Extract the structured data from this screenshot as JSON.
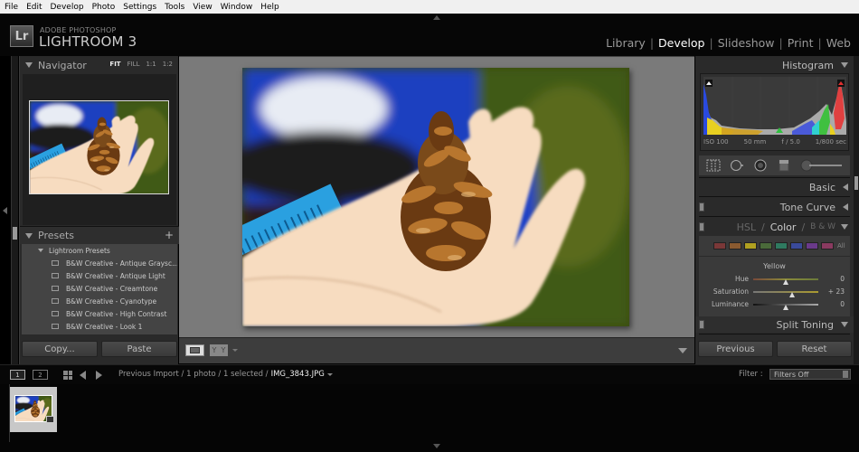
{
  "menubar": [
    "File",
    "Edit",
    "Develop",
    "Photo",
    "Settings",
    "Tools",
    "View",
    "Window",
    "Help"
  ],
  "app": {
    "logo": "Lr",
    "brand_line1": "ADOBE PHOTOSHOP",
    "brand_line2": "LIGHTROOM 3"
  },
  "modules": {
    "items": [
      "Library",
      "Develop",
      "Slideshow",
      "Print",
      "Web"
    ],
    "active": "Develop"
  },
  "navigator": {
    "title": "Navigator",
    "options": [
      "FIT",
      "FILL",
      "1:1",
      "1:2"
    ],
    "active_option": "FIT"
  },
  "presets": {
    "title": "Presets",
    "group": "Lightroom Presets",
    "items": [
      "B&W Creative - Antique Graysc...",
      "B&W Creative - Antique Light",
      "B&W Creative - Creamtone",
      "B&W Creative - Cyanotype",
      "B&W Creative - High Contrast",
      "B&W Creative - Look 1"
    ]
  },
  "left_buttons": {
    "copy": "Copy...",
    "paste": "Paste"
  },
  "right_buttons": {
    "previous": "Previous",
    "reset": "Reset"
  },
  "histogram": {
    "title": "Histogram",
    "iso": "ISO 100",
    "focal": "50 mm",
    "aperture": "f / 5.0",
    "shutter": "1/800 sec"
  },
  "panels": {
    "basic": "Basic",
    "tone_curve": "Tone Curve",
    "hsl": "HSL",
    "color": "Color",
    "bw": "B & W",
    "split_toning": "Split Toning"
  },
  "color_panel": {
    "swatches": [
      {
        "name": "red",
        "color": "#7a3838"
      },
      {
        "name": "orange",
        "color": "#8a5a30"
      },
      {
        "name": "yellow",
        "color": "#b0a020"
      },
      {
        "name": "green",
        "color": "#4a6a3a"
      },
      {
        "name": "aqua",
        "color": "#2f7a60"
      },
      {
        "name": "blue",
        "color": "#3a4a9a"
      },
      {
        "name": "purple",
        "color": "#6a3a8a"
      },
      {
        "name": "magenta",
        "color": "#8a3a60"
      }
    ],
    "all_label": "All",
    "selected": "Yellow",
    "sliders": [
      {
        "label": "Hue",
        "value": "0",
        "position": 0.5
      },
      {
        "label": "Saturation",
        "value": "+ 23",
        "position": 0.6
      },
      {
        "label": "Luminance",
        "value": "0",
        "position": 0.5
      }
    ]
  },
  "filmstrip": {
    "screen1": "1",
    "screen2": "2",
    "breadcrumb": "Previous Import / 1 photo / 1 selected /",
    "filename": "IMG_3843.JPG",
    "filter_label": "Filter :",
    "filter_value": "Filters Off"
  },
  "icons": {
    "view_mode": "loupe-icon",
    "before_after": "before-after-icon"
  }
}
